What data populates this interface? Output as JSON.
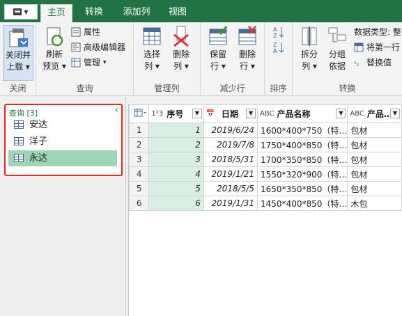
{
  "tabs": {
    "home": "主页",
    "transform": "转换",
    "add_column": "添加列",
    "view": "视图"
  },
  "ribbon": {
    "close_load_line1": "关闭并",
    "close_load_line2": "上载",
    "close_group": "关闭",
    "refresh_line1": "刷新",
    "refresh_line2": "预览",
    "properties": "属性",
    "advanced_editor": "高级编辑器",
    "manage": "管理",
    "query_group": "查询",
    "choose_cols_line1": "选择",
    "choose_cols_line2": "列",
    "remove_cols_line1": "删除",
    "remove_cols_line2": "列",
    "manage_cols_group": "管理列",
    "keep_rows_line1": "保留",
    "keep_rows_line2": "行",
    "remove_rows_line1": "删除",
    "remove_rows_line2": "行",
    "reduce_rows_group": "减少行",
    "sort_group": "排序",
    "split_line1": "拆分",
    "split_line2": "列",
    "groupby_line1": "分组",
    "groupby_line2": "依据",
    "data_type": "数据类型: 整",
    "first_row": "将第一行",
    "replace": "替换值",
    "transform_group": "转换"
  },
  "queries": {
    "header": "查询 [3]",
    "items": [
      "安达",
      "洋子",
      "永达"
    ],
    "selected_index": 2
  },
  "grid": {
    "columns": [
      {
        "type": "1²3",
        "name": "序号"
      },
      {
        "type": "📅",
        "name": "日期"
      },
      {
        "type": "ABC",
        "name": "产品名称"
      },
      {
        "type": "ABC",
        "name": "产品…"
      }
    ],
    "rows": [
      {
        "n": "1",
        "id": "1",
        "date": "2019/6/24",
        "product": "1600*400*750（特…",
        "pkg": "包材"
      },
      {
        "n": "2",
        "id": "2",
        "date": "2019/7/8",
        "product": "1750*400*850（特…",
        "pkg": "包材"
      },
      {
        "n": "3",
        "id": "3",
        "date": "2018/5/31",
        "product": "1700*350*850（特…",
        "pkg": "包材"
      },
      {
        "n": "4",
        "id": "4",
        "date": "2019/1/21",
        "product": "1550*320*900（特…",
        "pkg": "包材"
      },
      {
        "n": "5",
        "id": "5",
        "date": "2018/5/5",
        "product": "1650*350*850（特…",
        "pkg": "包材"
      },
      {
        "n": "6",
        "id": "6",
        "date": "2019/1/31",
        "product": "1450*400*850（特…",
        "pkg": "木包"
      }
    ]
  },
  "colors": {
    "accent": "#217346",
    "selected_query": "#9fd5b7",
    "highlight_border": "#e8271f",
    "number_col": "#d9efe3"
  }
}
